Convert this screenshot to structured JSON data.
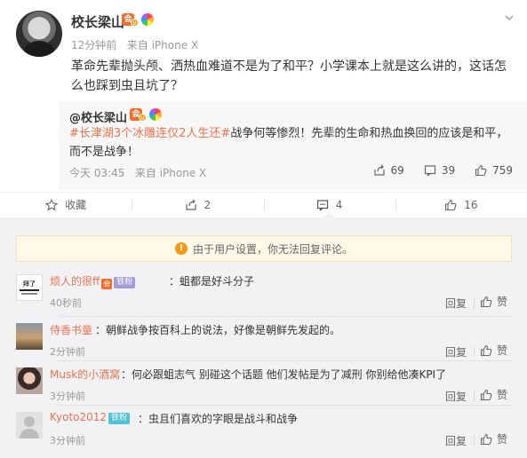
{
  "post": {
    "author": "校长梁山",
    "time": "12分钟前",
    "source": "来自 iPhone X",
    "text": "革命先辈抛头颅、洒热血难道不是为了和平？小学课本上就是这么讲的，这话怎么也踩到虫且坑了？",
    "repost": {
      "author": "@校长梁山",
      "topic": "#长津湖3个冰雕连仅2人生还#",
      "text": "战争何等惨烈！先辈的生命和热血换回的应该是和平，而不是战争！",
      "time": "今天 03:45",
      "source": "来自 iPhone X",
      "stats": {
        "share": "69",
        "comment": "39",
        "like": "759"
      }
    }
  },
  "actions": {
    "favorite": "收藏",
    "repost": "2",
    "comment": "4",
    "like": "16"
  },
  "comments": {
    "notice": "由于用户设置，你无法回复评论。",
    "reply_label": "回复",
    "like_label": "赞",
    "items": [
      {
        "name": "烦人的很ff",
        "badge": "铁粉",
        "text": "：蛆都是好斗分子",
        "time": "40秒前",
        "avatar_text": "拜了"
      },
      {
        "name": "侍香书童",
        "badge": "",
        "text": "：朝鲜战争按百科上的说法，好像是朝鲜先发起的。",
        "time": "2分钟前",
        "avatar_text": ""
      },
      {
        "name": "Musk的小酒窝",
        "badge": "",
        "text": "：何必跟蛆志气  别碰这个话题  他们发帖是为了减刑  你别给他凑KPI了",
        "time": "3分钟前",
        "avatar_text": ""
      },
      {
        "name": "Kyoto2012",
        "badge": "铁粉",
        "text": "：虫且们喜欢的字眼是战斗和战争",
        "time": "3分钟前",
        "avatar_text": ""
      }
    ]
  },
  "colors": {
    "link_orange": "#eb7350",
    "comment_bg": "#f2f2f5",
    "repost_bg": "#f7f7f7",
    "notice_bg": "#fef8e8"
  }
}
